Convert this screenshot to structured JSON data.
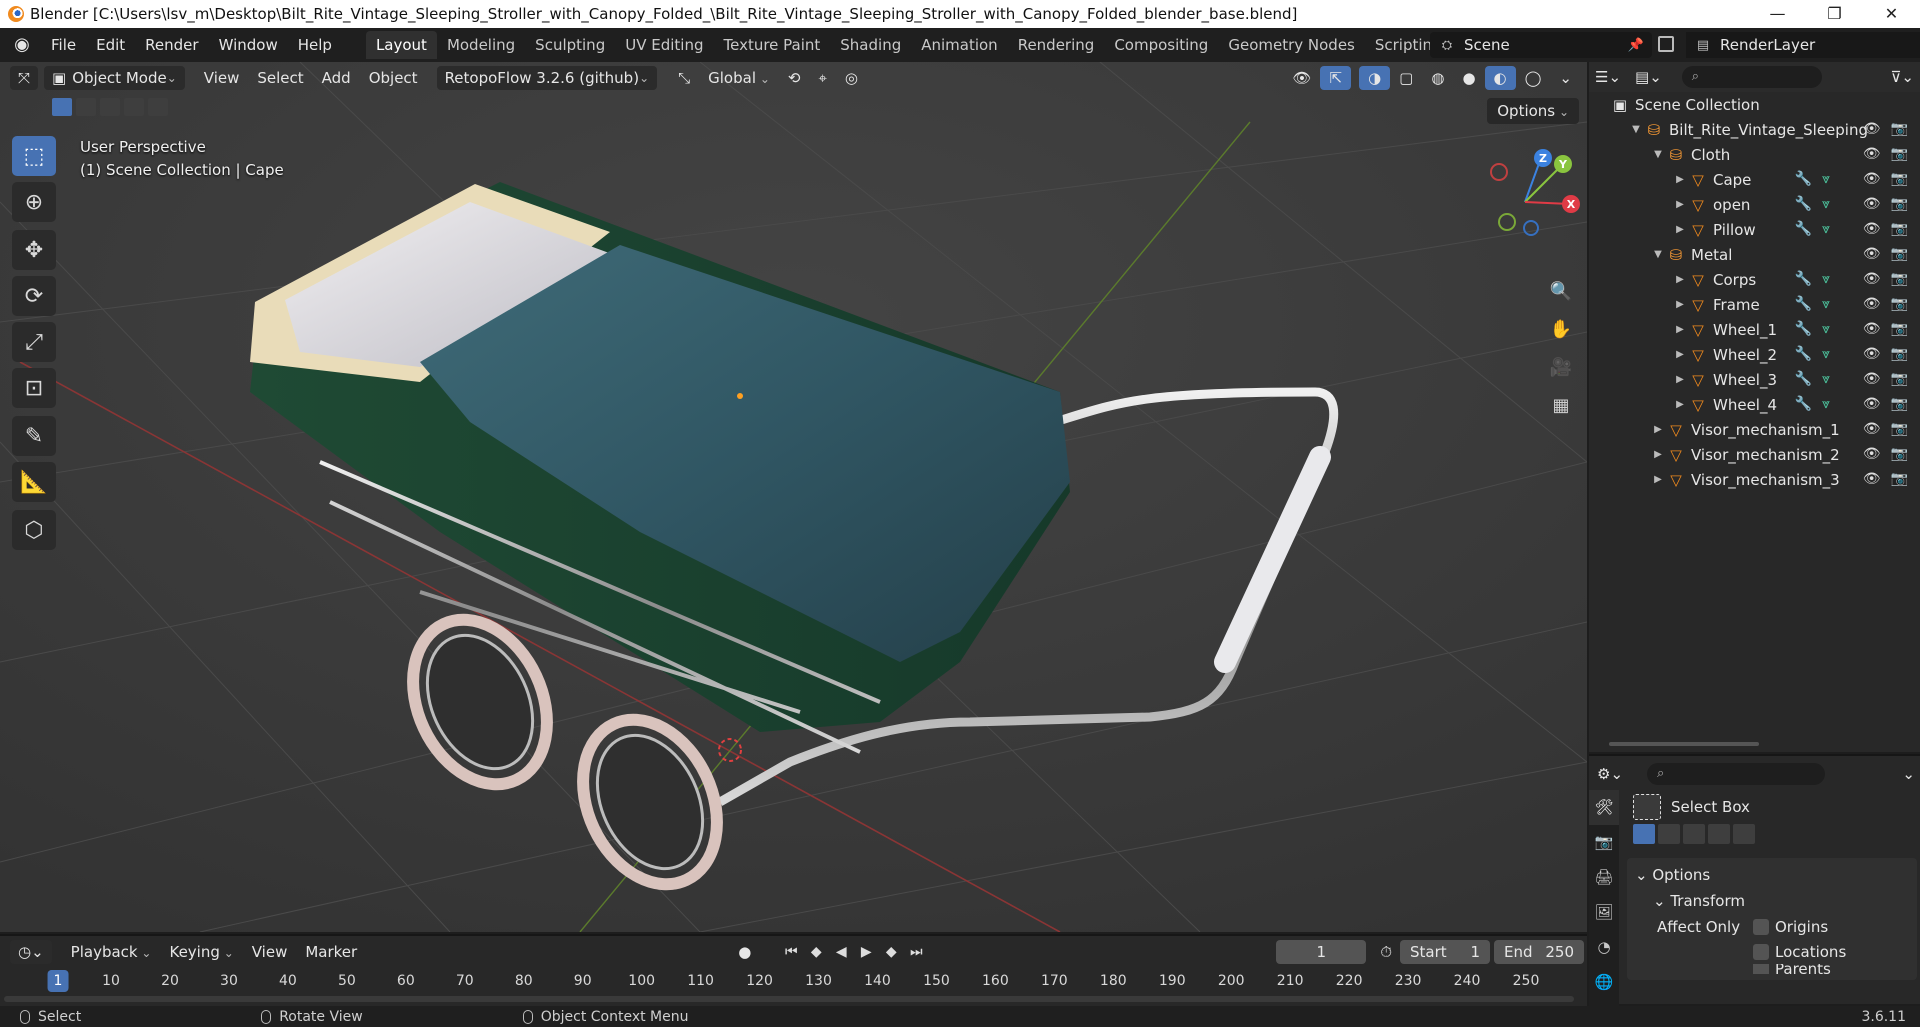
{
  "window": {
    "title": "Blender [C:\\Users\\lsv_m\\Desktop\\Bilt_Rite_Vintage_Sleeping_Stroller_with_Canopy_Folded_\\Bilt_Rite_Vintage_Sleeping_Stroller_with_Canopy_Folded_blender_base.blend]",
    "minimize": "—",
    "maximize": "❐",
    "close": "✕"
  },
  "menu": [
    "File",
    "Edit",
    "Render",
    "Window",
    "Help"
  ],
  "workspaces": [
    "Layout",
    "Modeling",
    "Sculpting",
    "UV Editing",
    "Texture Paint",
    "Shading",
    "Animation",
    "Rendering",
    "Compositing",
    "Geometry Nodes",
    "Scripting"
  ],
  "workspace_add": "+",
  "scene": "Scene",
  "render_layer": "RenderLayer",
  "viewport": {
    "mode": "Object Mode",
    "menus": [
      "View",
      "Select",
      "Add",
      "Object"
    ],
    "addon": "RetopoFlow 3.2.6 (github)",
    "orientation": "Global",
    "options": "Options",
    "perspective": "User Perspective",
    "collection_info": "(1) Scene Collection | Cape",
    "gizmo": {
      "x": "X",
      "y": "Y",
      "z": "Z"
    }
  },
  "outliner": {
    "search_placeholder": "⌕",
    "root": "Scene Collection",
    "items": [
      {
        "label": "Bilt_Rite_Vintage_Sleeping",
        "type": "collection",
        "depth": 1,
        "expanded": true
      },
      {
        "label": "Cloth",
        "type": "collection",
        "depth": 2,
        "expanded": true
      },
      {
        "label": "Cape",
        "type": "mesh",
        "depth": 3,
        "mods": true
      },
      {
        "label": "open",
        "type": "mesh",
        "depth": 3,
        "mods": true
      },
      {
        "label": "Pillow",
        "type": "mesh",
        "depth": 3,
        "mods": true
      },
      {
        "label": "Metal",
        "type": "collection",
        "depth": 2,
        "expanded": true
      },
      {
        "label": "Corps",
        "type": "mesh",
        "depth": 3,
        "mods": true
      },
      {
        "label": "Frame",
        "type": "mesh",
        "depth": 3,
        "mods": true
      },
      {
        "label": "Wheel_1",
        "type": "mesh",
        "depth": 3,
        "mods": true
      },
      {
        "label": "Wheel_2",
        "type": "mesh",
        "depth": 3,
        "mods": true
      },
      {
        "label": "Wheel_3",
        "type": "mesh",
        "depth": 3,
        "mods": true
      },
      {
        "label": "Wheel_4",
        "type": "mesh",
        "depth": 3,
        "mods": true
      },
      {
        "label": "Visor_mechanism_1",
        "type": "mesh",
        "depth": 2,
        "mods": false
      },
      {
        "label": "Visor_mechanism_2",
        "type": "mesh",
        "depth": 2,
        "mods": false
      },
      {
        "label": "Visor_mechanism_3",
        "type": "mesh",
        "depth": 2,
        "mods": false
      }
    ]
  },
  "properties": {
    "tool_name": "Select Box",
    "options_panel": "Options",
    "transform_panel": "Transform",
    "affect_only": "Affect Only",
    "checks": [
      "Origins",
      "Locations",
      "Parents"
    ]
  },
  "timeline": {
    "menus": [
      "Playback",
      "Keying",
      "View",
      "Marker"
    ],
    "current_frame": "1",
    "start_label": "Start",
    "start": "1",
    "end_label": "End",
    "end": "250",
    "frames": [
      "1",
      "10",
      "20",
      "30",
      "40",
      "50",
      "60",
      "70",
      "80",
      "90",
      "100",
      "110",
      "120",
      "130",
      "140",
      "150",
      "160",
      "170",
      "180",
      "190",
      "200",
      "210",
      "220",
      "230",
      "240",
      "250"
    ]
  },
  "status": {
    "select": "Select",
    "rotate": "Rotate View",
    "context": "Object Context Menu",
    "version": "3.6.11"
  },
  "colors": {
    "accent": "#4772b3",
    "x_axis": "#e03b46",
    "y_axis": "#8ac53f",
    "z_axis": "#3b82e0",
    "mesh_icon": "#f08a1e"
  }
}
